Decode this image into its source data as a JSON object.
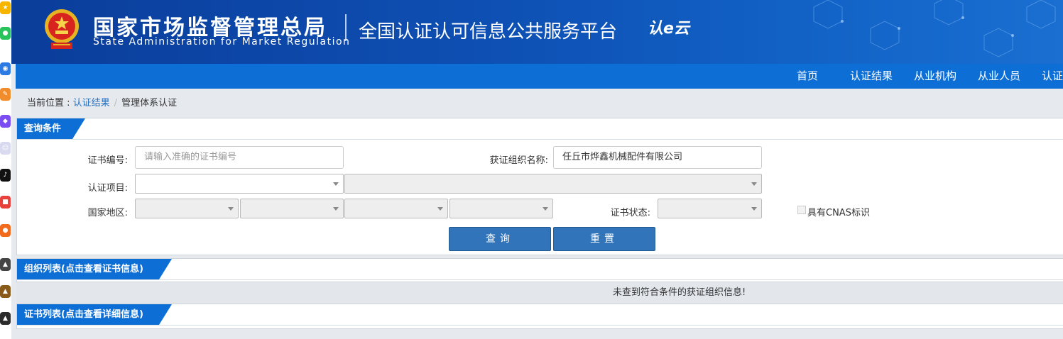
{
  "header": {
    "cn_title": "国家市场监督管理总局",
    "en_title": "State Administration  for  Market Regulation",
    "platform": "全国认证认可信息公共服务平台",
    "logo_text": "认e云"
  },
  "nav": {
    "items": [
      {
        "label": "首页"
      },
      {
        "label": "认证结果"
      },
      {
        "label": "从业机构"
      },
      {
        "label": "从业人员"
      },
      {
        "label": "认证"
      }
    ]
  },
  "breadcrumb": {
    "prefix": "当前位置 : ",
    "link": "认证结果",
    "separator": "/",
    "current": "管理体系认证"
  },
  "query": {
    "title": "查询条件",
    "cert_no_label": "证书编号:",
    "cert_no_placeholder": "请输入准确的证书编号",
    "org_label": "获证组织名称:",
    "org_value": "任丘市烨鑫机械配件有限公司",
    "project_label": "认证项目:",
    "region_label": "国家地区:",
    "status_label": "证书状态:",
    "cnas_label": "具有CNAS标识",
    "search_button": "查询",
    "reset_button": "重置"
  },
  "org_list": {
    "title": "组织列表(点击查看证书信息)",
    "empty_message": "未查到符合条件的获证组织信息!"
  },
  "cert_list": {
    "title": "证书列表(点击查看详细信息)"
  },
  "colors": {
    "header_bg": "#0e4fb3",
    "nav_bg": "#0d6fd6",
    "button_bg": "#3274ba",
    "link": "#2470c2"
  }
}
